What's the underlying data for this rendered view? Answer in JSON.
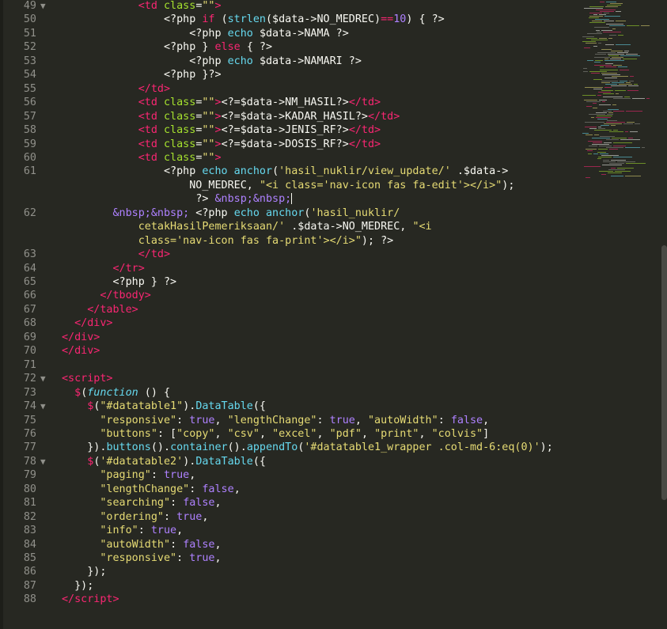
{
  "editor": {
    "lines": [
      {
        "n": "49",
        "fold": true,
        "indent": "            ",
        "parts": [
          [
            "tag",
            "<td "
          ],
          [
            "attr",
            "class"
          ],
          [
            "php",
            "="
          ],
          [
            "str",
            "\"\""
          ],
          [
            "tag",
            ">"
          ]
        ]
      },
      {
        "n": "50",
        "fold": false,
        "indent": "                ",
        "parts": [
          [
            "php",
            "<?php "
          ],
          [
            "kw",
            "if "
          ],
          [
            "php",
            "("
          ],
          [
            "fn",
            "strlen"
          ],
          [
            "php",
            "($data->NO_MEDREC)"
          ],
          [
            "kw",
            "=="
          ],
          [
            "num",
            "10"
          ],
          [
            "php",
            ") { ?>"
          ]
        ]
      },
      {
        "n": "51",
        "fold": false,
        "indent": "                    ",
        "parts": [
          [
            "php",
            "<?php "
          ],
          [
            "fn",
            "echo "
          ],
          [
            "php",
            "$data->NAMA ?>"
          ]
        ]
      },
      {
        "n": "52",
        "fold": false,
        "indent": "                ",
        "parts": [
          [
            "php",
            "<?php } "
          ],
          [
            "kw",
            "else "
          ],
          [
            "php",
            "{ ?>"
          ]
        ]
      },
      {
        "n": "53",
        "fold": false,
        "indent": "                    ",
        "parts": [
          [
            "php",
            "<?php "
          ],
          [
            "fn",
            "echo "
          ],
          [
            "php",
            "$data->NAMARI ?>"
          ]
        ]
      },
      {
        "n": "54",
        "fold": false,
        "indent": "                ",
        "parts": [
          [
            "php",
            "<?php }?>"
          ]
        ]
      },
      {
        "n": "55",
        "fold": false,
        "indent": "            ",
        "parts": [
          [
            "tag",
            "</td>"
          ]
        ]
      },
      {
        "n": "56",
        "fold": false,
        "indent": "            ",
        "parts": [
          [
            "tag",
            "<td "
          ],
          [
            "attr",
            "class"
          ],
          [
            "php",
            "="
          ],
          [
            "str",
            "\"\""
          ],
          [
            "tag",
            ">"
          ],
          [
            "php",
            "<?=$data->NM_HASIL?>"
          ],
          [
            "tag",
            "</td>"
          ]
        ]
      },
      {
        "n": "57",
        "fold": false,
        "indent": "            ",
        "parts": [
          [
            "tag",
            "<td "
          ],
          [
            "attr",
            "class"
          ],
          [
            "php",
            "="
          ],
          [
            "str",
            "\"\""
          ],
          [
            "tag",
            ">"
          ],
          [
            "php",
            "<?=$data->KADAR_HASIL?>"
          ],
          [
            "tag",
            "</td>"
          ]
        ]
      },
      {
        "n": "58",
        "fold": false,
        "indent": "            ",
        "parts": [
          [
            "tag",
            "<td "
          ],
          [
            "attr",
            "class"
          ],
          [
            "php",
            "="
          ],
          [
            "str",
            "\"\""
          ],
          [
            "tag",
            ">"
          ],
          [
            "php",
            "<?=$data->JENIS_RF?>"
          ],
          [
            "tag",
            "</td>"
          ]
        ]
      },
      {
        "n": "59",
        "fold": false,
        "indent": "            ",
        "parts": [
          [
            "tag",
            "<td "
          ],
          [
            "attr",
            "class"
          ],
          [
            "php",
            "="
          ],
          [
            "str",
            "\"\""
          ],
          [
            "tag",
            ">"
          ],
          [
            "php",
            "<?=$data->DOSIS_RF?>"
          ],
          [
            "tag",
            "</td>"
          ]
        ]
      },
      {
        "n": "60",
        "fold": false,
        "indent": "            ",
        "parts": [
          [
            "tag",
            "<td "
          ],
          [
            "attr",
            "class"
          ],
          [
            "php",
            "="
          ],
          [
            "str",
            "\"\""
          ],
          [
            "tag",
            ">"
          ]
        ]
      },
      {
        "n": "61",
        "fold": false,
        "indent": "                ",
        "parts": [
          [
            "php",
            "<?php "
          ],
          [
            "fn",
            "echo anchor"
          ],
          [
            "php",
            "("
          ],
          [
            "str",
            "'hasil_nuklir/view_update/'"
          ],
          [
            "php",
            " .$data->"
          ]
        ]
      },
      {
        "n": "",
        "fold": false,
        "indent": "                    ",
        "parts": [
          [
            "php",
            "NO_MEDREC, "
          ],
          [
            "str",
            "\"<i class='nav-icon fas fa-edit'></i>\""
          ],
          [
            "php",
            ");"
          ]
        ]
      },
      {
        "n": "",
        "fold": false,
        "indent": "                     ",
        "parts": [
          [
            "php",
            "?> "
          ],
          [
            "ent",
            "&nbsp;&nbsp;"
          ],
          [
            "caret",
            ""
          ]
        ]
      },
      {
        "n": "62",
        "fold": false,
        "indent": "        ",
        "parts": [
          [
            "ent",
            "&nbsp;&nbsp;"
          ],
          [
            "php",
            " <?php "
          ],
          [
            "fn",
            "echo anchor"
          ],
          [
            "php",
            "("
          ],
          [
            "str",
            "'hasil_nuklir/"
          ]
        ]
      },
      {
        "n": "",
        "fold": false,
        "indent": "            ",
        "parts": [
          [
            "str",
            "cetakHasilPemeriksaan/'"
          ],
          [
            "php",
            " .$data->NO_MEDREC, "
          ],
          [
            "str",
            "\"<i"
          ]
        ]
      },
      {
        "n": "",
        "fold": false,
        "indent": "            ",
        "parts": [
          [
            "str",
            "class='nav-icon fas fa-print'></i>\""
          ],
          [
            "php",
            "); ?>"
          ]
        ]
      },
      {
        "n": "63",
        "fold": false,
        "indent": "            ",
        "parts": [
          [
            "tag",
            "</td>"
          ]
        ]
      },
      {
        "n": "64",
        "fold": false,
        "indent": "        ",
        "parts": [
          [
            "tag",
            "</tr>"
          ]
        ]
      },
      {
        "n": "65",
        "fold": false,
        "indent": "        ",
        "parts": [
          [
            "php",
            "<?php } ?>"
          ]
        ]
      },
      {
        "n": "66",
        "fold": false,
        "indent": "      ",
        "parts": [
          [
            "tag",
            "</tbody>"
          ]
        ]
      },
      {
        "n": "67",
        "fold": false,
        "indent": "    ",
        "parts": [
          [
            "tag",
            "</table>"
          ]
        ]
      },
      {
        "n": "68",
        "fold": false,
        "indent": "  ",
        "parts": [
          [
            "tag",
            "</div>"
          ]
        ]
      },
      {
        "n": "69",
        "fold": false,
        "indent": "",
        "parts": [
          [
            "tag",
            "</div>"
          ]
        ]
      },
      {
        "n": "70",
        "fold": false,
        "indent": "",
        "parts": [
          [
            "tag",
            "</div>"
          ]
        ]
      },
      {
        "n": "71",
        "fold": false,
        "indent": "",
        "parts": []
      },
      {
        "n": "72",
        "fold": true,
        "indent": "",
        "parts": [
          [
            "tag",
            "<script>"
          ]
        ]
      },
      {
        "n": "73",
        "fold": false,
        "indent": "  ",
        "parts": [
          [
            "kw",
            "$"
          ],
          [
            "php",
            "("
          ],
          [
            "it",
            "function"
          ],
          [
            "php",
            " () {"
          ]
        ]
      },
      {
        "n": "74",
        "fold": true,
        "indent": "    ",
        "parts": [
          [
            "kw",
            "$"
          ],
          [
            "php",
            "("
          ],
          [
            "str",
            "\"#datatable1\""
          ],
          [
            "php",
            ")."
          ],
          [
            "fn",
            "DataTable"
          ],
          [
            "php",
            "({"
          ]
        ]
      },
      {
        "n": "75",
        "fold": false,
        "indent": "      ",
        "parts": [
          [
            "str",
            "\"responsive\""
          ],
          [
            "php",
            ": "
          ],
          [
            "num",
            "true"
          ],
          [
            "php",
            ", "
          ],
          [
            "str",
            "\"lengthChange\""
          ],
          [
            "php",
            ": "
          ],
          [
            "num",
            "true"
          ],
          [
            "php",
            ", "
          ],
          [
            "str",
            "\"autoWidth\""
          ],
          [
            "php",
            ": "
          ],
          [
            "num",
            "false"
          ],
          [
            "php",
            ","
          ]
        ]
      },
      {
        "n": "76",
        "fold": false,
        "indent": "      ",
        "parts": [
          [
            "str",
            "\"buttons\""
          ],
          [
            "php",
            ": ["
          ],
          [
            "str",
            "\"copy\""
          ],
          [
            "php",
            ", "
          ],
          [
            "str",
            "\"csv\""
          ],
          [
            "php",
            ", "
          ],
          [
            "str",
            "\"excel\""
          ],
          [
            "php",
            ", "
          ],
          [
            "str",
            "\"pdf\""
          ],
          [
            "php",
            ", "
          ],
          [
            "str",
            "\"print\""
          ],
          [
            "php",
            ", "
          ],
          [
            "str",
            "\"colvis\""
          ],
          [
            "php",
            "]"
          ]
        ]
      },
      {
        "n": "77",
        "fold": false,
        "indent": "    ",
        "parts": [
          [
            "php",
            "})."
          ],
          [
            "fn",
            "buttons"
          ],
          [
            "php",
            "()."
          ],
          [
            "fn",
            "container"
          ],
          [
            "php",
            "()."
          ],
          [
            "fn",
            "appendTo"
          ],
          [
            "php",
            "("
          ],
          [
            "str",
            "'#datatable1_wrapper .col-md-6:eq(0)'"
          ],
          [
            "php",
            ");"
          ]
        ]
      },
      {
        "n": "78",
        "fold": true,
        "indent": "    ",
        "parts": [
          [
            "kw",
            "$"
          ],
          [
            "php",
            "("
          ],
          [
            "str",
            "'#datatable2'"
          ],
          [
            "php",
            ")."
          ],
          [
            "fn",
            "DataTable"
          ],
          [
            "php",
            "({"
          ]
        ]
      },
      {
        "n": "79",
        "fold": false,
        "indent": "      ",
        "parts": [
          [
            "str",
            "\"paging\""
          ],
          [
            "php",
            ": "
          ],
          [
            "num",
            "true"
          ],
          [
            "php",
            ","
          ]
        ]
      },
      {
        "n": "80",
        "fold": false,
        "indent": "      ",
        "parts": [
          [
            "str",
            "\"lengthChange\""
          ],
          [
            "php",
            ": "
          ],
          [
            "num",
            "false"
          ],
          [
            "php",
            ","
          ]
        ]
      },
      {
        "n": "81",
        "fold": false,
        "indent": "      ",
        "parts": [
          [
            "str",
            "\"searching\""
          ],
          [
            "php",
            ": "
          ],
          [
            "num",
            "false"
          ],
          [
            "php",
            ","
          ]
        ]
      },
      {
        "n": "82",
        "fold": false,
        "indent": "      ",
        "parts": [
          [
            "str",
            "\"ordering\""
          ],
          [
            "php",
            ": "
          ],
          [
            "num",
            "true"
          ],
          [
            "php",
            ","
          ]
        ]
      },
      {
        "n": "83",
        "fold": false,
        "indent": "      ",
        "parts": [
          [
            "str",
            "\"info\""
          ],
          [
            "php",
            ": "
          ],
          [
            "num",
            "true"
          ],
          [
            "php",
            ","
          ]
        ]
      },
      {
        "n": "84",
        "fold": false,
        "indent": "      ",
        "parts": [
          [
            "str",
            "\"autoWidth\""
          ],
          [
            "php",
            ": "
          ],
          [
            "num",
            "false"
          ],
          [
            "php",
            ","
          ]
        ]
      },
      {
        "n": "85",
        "fold": false,
        "indent": "      ",
        "parts": [
          [
            "str",
            "\"responsive\""
          ],
          [
            "php",
            ": "
          ],
          [
            "num",
            "true"
          ],
          [
            "php",
            ","
          ]
        ]
      },
      {
        "n": "86",
        "fold": false,
        "indent": "    ",
        "parts": [
          [
            "php",
            "});"
          ]
        ]
      },
      {
        "n": "87",
        "fold": false,
        "indent": "  ",
        "parts": [
          [
            "php",
            "});"
          ]
        ]
      },
      {
        "n": "88",
        "fold": false,
        "indent": "",
        "parts": [
          [
            "tag",
            "</"
          ],
          [
            "tag",
            "script"
          ],
          [
            "tag",
            ">"
          ]
        ]
      }
    ]
  },
  "colors": {
    "background": "#272822",
    "tag": "#f92672",
    "attribute": "#a6e22e",
    "string": "#e6db74",
    "number": "#ae81ff",
    "function": "#66d9ef",
    "line_number": "#90908a"
  },
  "scrollbar": {
    "position": 0.39
  }
}
